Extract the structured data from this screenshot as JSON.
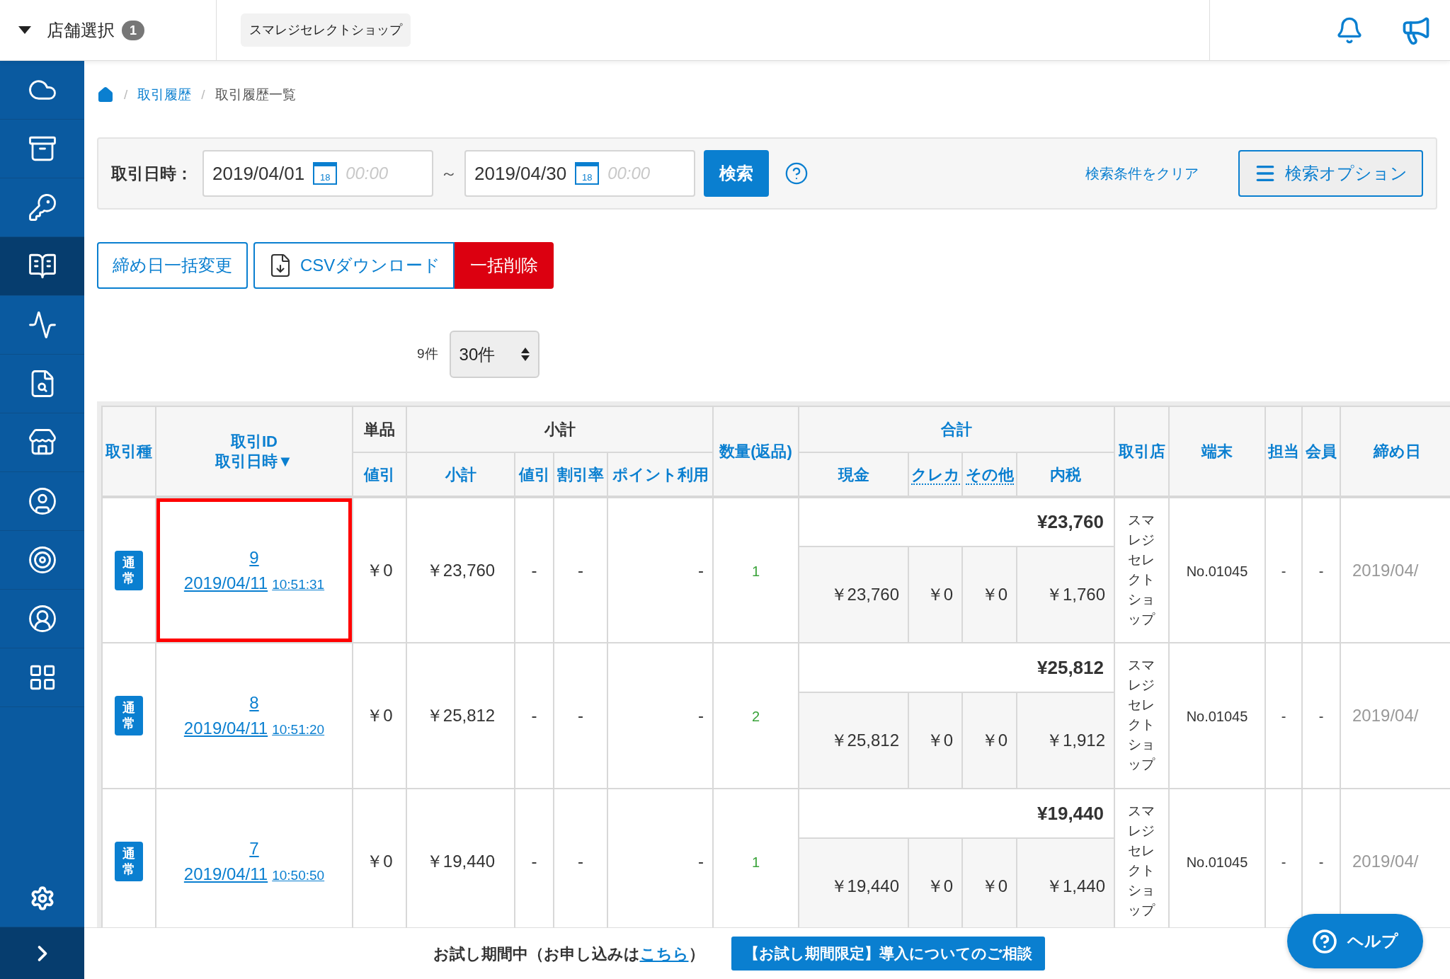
{
  "header": {
    "store_select": {
      "label": "店舗選択",
      "count": "1"
    },
    "shop_chip": "スマレジセレクトショップ"
  },
  "sidebar": {
    "items": [
      {
        "selected": false
      },
      {
        "selected": false
      },
      {
        "selected": false
      },
      {
        "selected": true
      },
      {
        "selected": false
      },
      {
        "selected": false
      },
      {
        "selected": false
      },
      {
        "selected": false
      },
      {
        "selected": false
      },
      {
        "selected": false
      },
      {
        "selected": false
      }
    ]
  },
  "breadcrumb": {
    "separator": "/",
    "items": [
      "取引履歴",
      "取引履歴一覧"
    ]
  },
  "filter": {
    "label": "取引日時：",
    "from": {
      "date": "2019/04/01",
      "calendar_day": "18",
      "placeholder": "00:00"
    },
    "separator": "～",
    "to": {
      "date": "2019/04/30",
      "calendar_day": "18",
      "placeholder": "00:00"
    },
    "search_button": "検索",
    "clear_link": "検索条件をクリア",
    "options_button": "検索オプション"
  },
  "actions": [
    {
      "kind": "outline",
      "label": "締め日一括変更"
    },
    {
      "kind": "download",
      "label": "CSVダウンロード"
    },
    {
      "kind": "danger",
      "label": "一括削除"
    }
  ],
  "result_count": "9件",
  "page_size": "30件",
  "table": {
    "columns": [
      {
        "label": "取引種",
        "link": true
      },
      {
        "label": "取引ID",
        "label2": "取引日時▼",
        "link": true
      },
      {
        "label": "単品",
        "link": false,
        "children": [
          {
            "label": "値引",
            "hint": false
          }
        ]
      },
      {
        "label": "小計",
        "link": false,
        "children": [
          {
            "label": "小計",
            "hint": false
          },
          {
            "label": "値引",
            "hint": false
          },
          {
            "label": "割引率",
            "hint": false
          },
          {
            "label": "ポイント利用",
            "hint": false
          }
        ]
      },
      {
        "label": "数量(返品)",
        "link": true
      },
      {
        "label": "合計",
        "link": true,
        "children": [
          {
            "label": "現金",
            "hint": false
          },
          {
            "label": "クレカ",
            "hint": true
          },
          {
            "label": "その他",
            "hint": true
          },
          {
            "label": "内税",
            "hint": false
          }
        ]
      },
      {
        "label": "取引店",
        "link": true
      },
      {
        "label": "端末",
        "link": true
      },
      {
        "label": "担当",
        "link": true
      },
      {
        "label": "会員",
        "link": true
      },
      {
        "label": "締め日",
        "link": true
      }
    ],
    "rows": [
      {
        "type": "通常",
        "id": "9",
        "date": "2019/04/11",
        "time": "10:51:31",
        "highlighted": true,
        "unit_discount": "￥0",
        "subtotal": "￥23,760",
        "discount": "-",
        "discount_rate": "-",
        "points": "-",
        "quantity": "1",
        "total": "¥23,760",
        "breakdown": [
          "￥23,760",
          "￥0",
          "￥0",
          "￥1,760"
        ],
        "store": "スマレジセレクトショップ",
        "terminal": "No.01045",
        "staff": "-",
        "member": "-",
        "closing_date": "2019/04/"
      },
      {
        "type": "通常",
        "id": "8",
        "date": "2019/04/11",
        "time": "10:51:20",
        "highlighted": false,
        "unit_discount": "￥0",
        "subtotal": "￥25,812",
        "discount": "-",
        "discount_rate": "-",
        "points": "-",
        "quantity": "2",
        "total": "¥25,812",
        "breakdown": [
          "￥25,812",
          "￥0",
          "￥0",
          "￥1,912"
        ],
        "store": "スマレジセレクトショップ",
        "terminal": "No.01045",
        "staff": "-",
        "member": "-",
        "closing_date": "2019/04/"
      },
      {
        "type": "通常",
        "id": "7",
        "date": "2019/04/11",
        "time": "10:50:50",
        "highlighted": false,
        "unit_discount": "￥0",
        "subtotal": "￥19,440",
        "discount": "-",
        "discount_rate": "-",
        "points": "-",
        "quantity": "1",
        "total": "¥19,440",
        "breakdown": [
          "￥19,440",
          "￥0",
          "￥0",
          "￥1,440"
        ],
        "store": "スマレジセレクトショップ",
        "terminal": "No.01045",
        "staff": "-",
        "member": "-",
        "closing_date": "2019/04/"
      }
    ]
  },
  "footer": {
    "notice_before": "お試し期間中（お申し込みは",
    "notice_link": "こちら",
    "notice_after": "）",
    "consult_button": "【お試し期間限定】導入についてのご相談",
    "help_button": "ヘルプ"
  }
}
